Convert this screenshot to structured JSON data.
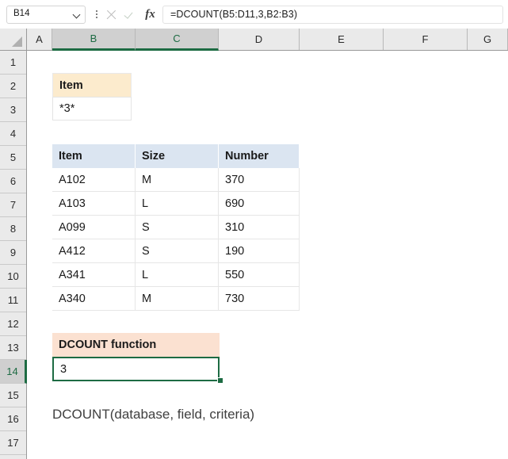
{
  "app": {
    "name_box_value": "B14",
    "formula": "=DCOUNT(B5:D11,3,B2:B3)",
    "icons": {
      "name_box_dropdown": "chevron-down-icon",
      "more_options": "vertical-dots-icon",
      "cancel": "cancel-x-icon",
      "enter": "confirm-check-icon",
      "insert_function": "fx-icon"
    }
  },
  "grid": {
    "columns": [
      {
        "label": "A",
        "selected": false
      },
      {
        "label": "B",
        "selected": true
      },
      {
        "label": "C",
        "selected": true
      },
      {
        "label": "D",
        "selected": false
      },
      {
        "label": "E",
        "selected": false
      },
      {
        "label": "F",
        "selected": false
      },
      {
        "label": "G",
        "selected": false
      }
    ],
    "rows": [
      {
        "label": "1",
        "selected": false
      },
      {
        "label": "2",
        "selected": false
      },
      {
        "label": "3",
        "selected": false
      },
      {
        "label": "4",
        "selected": false
      },
      {
        "label": "5",
        "selected": false
      },
      {
        "label": "6",
        "selected": false
      },
      {
        "label": "7",
        "selected": false
      },
      {
        "label": "8",
        "selected": false
      },
      {
        "label": "9",
        "selected": false
      },
      {
        "label": "10",
        "selected": false
      },
      {
        "label": "11",
        "selected": false
      },
      {
        "label": "12",
        "selected": false
      },
      {
        "label": "13",
        "selected": false
      },
      {
        "label": "14",
        "selected": true
      },
      {
        "label": "15",
        "selected": false
      },
      {
        "label": "16",
        "selected": false
      },
      {
        "label": "17",
        "selected": false
      }
    ]
  },
  "criteria_range": {
    "header": "Item",
    "value": "*3*"
  },
  "database_table": {
    "headers": [
      "Item",
      "Size",
      "Number"
    ],
    "rows": [
      [
        "A102",
        "M",
        "370"
      ],
      [
        "A103",
        "L",
        "690"
      ],
      [
        "A099",
        "S",
        "310"
      ],
      [
        "A412",
        "S",
        "190"
      ],
      [
        "A341",
        "L",
        "550"
      ],
      [
        "A340",
        "M",
        "730"
      ]
    ]
  },
  "result": {
    "label": "DCOUNT function",
    "value": "3"
  },
  "syntax_note": "DCOUNT(database, field, criteria)",
  "colors": {
    "selection_green": "#1d6b43",
    "criteria_header": "#fcebcd",
    "table_header": "#dbe5f1",
    "result_label": "#fbe1d1"
  }
}
